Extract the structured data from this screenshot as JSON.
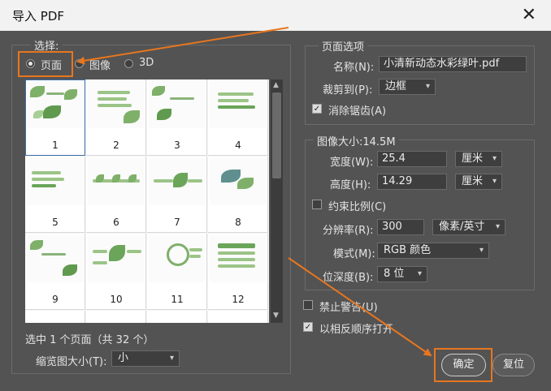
{
  "window": {
    "title": "导入 PDF",
    "close_symbol": "✕"
  },
  "select_group": {
    "legend": "选择:",
    "options": [
      {
        "label": "页面",
        "checked": true
      },
      {
        "label": "图像",
        "checked": false
      },
      {
        "label": "3D",
        "checked": false
      }
    ]
  },
  "pages": [
    "1",
    "2",
    "3",
    "4",
    "5",
    "6",
    "7",
    "8",
    "9",
    "10",
    "11",
    "12"
  ],
  "status": {
    "selection_text": "选中 1 个页面（共 32 个）"
  },
  "thumbnail_size": {
    "label": "缩览图大小(T):",
    "value": "小"
  },
  "page_options": {
    "legend": "页面选项",
    "name_label": "名称(N):",
    "name_value": "小清新动态水彩绿叶.pdf",
    "crop_label": "裁剪到(P):",
    "crop_value": "边框",
    "antialias_label": "消除锯齿(A)",
    "antialias_checked": true
  },
  "image_size": {
    "legend": "图像大小:14.5M",
    "width_label": "宽度(W):",
    "width_value": "25.4",
    "width_unit": "厘米",
    "height_label": "高度(H):",
    "height_value": "14.29",
    "height_unit": "厘米",
    "constrain_label": "约束比例(C)",
    "constrain_checked": false,
    "resolution_label": "分辨率(R):",
    "resolution_value": "300",
    "resolution_unit": "像素/英寸",
    "mode_label": "模式(M):",
    "mode_value": "RGB 颜色",
    "depth_label": "位深度(B):",
    "depth_value": "8 位"
  },
  "options": {
    "suppress_warnings_label": "禁止警告(U)",
    "suppress_warnings_checked": false,
    "reverse_order_label": "以相反顺序打开",
    "reverse_order_checked": true
  },
  "buttons": {
    "ok": "确定",
    "reset": "复位"
  },
  "colors": {
    "annotation": "#e8761f",
    "background": "#535353",
    "selection": "#3b6ea8"
  }
}
